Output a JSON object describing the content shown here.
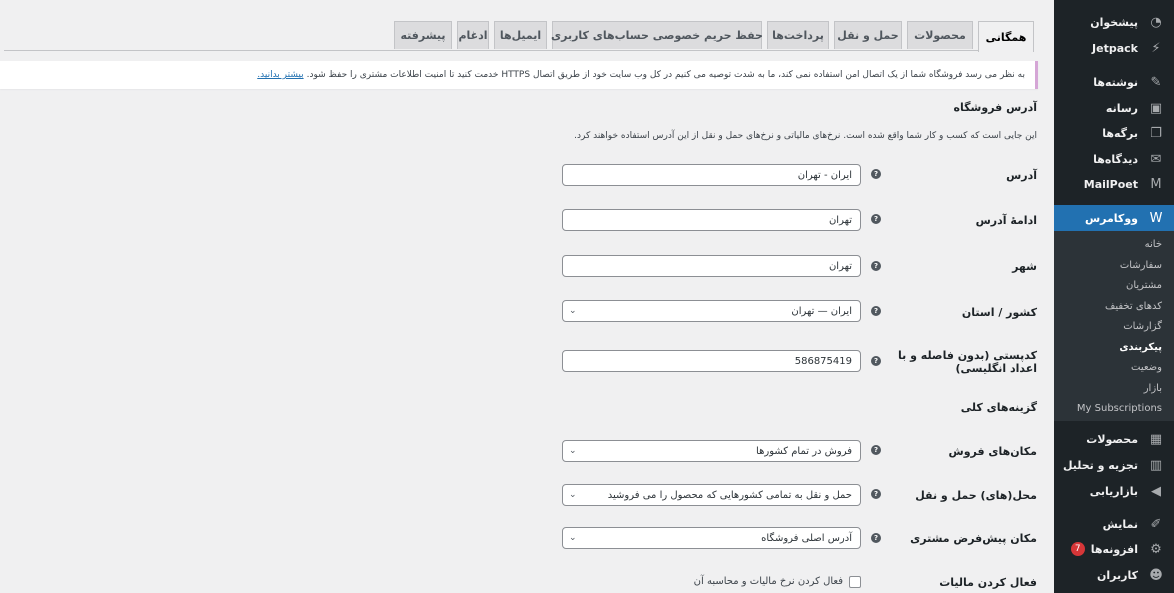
{
  "sidebar": {
    "items": [
      {
        "label": "پیشخوان",
        "icon": "dashboard-icon",
        "glyph": "◔"
      },
      {
        "label": "Jetpack",
        "icon": "jetpack-icon",
        "glyph": "⚡"
      },
      {
        "label": "نوشته‌ها",
        "icon": "pin-icon",
        "glyph": "✎"
      },
      {
        "label": "رسانه",
        "icon": "media-icon",
        "glyph": "▣"
      },
      {
        "label": "برگه‌ها",
        "icon": "pages-icon",
        "glyph": "❐"
      },
      {
        "label": "دیدگاه‌ها",
        "icon": "comments-icon",
        "glyph": "✉"
      },
      {
        "label": "MailPoet",
        "icon": "mailpoet-icon",
        "glyph": "M"
      },
      {
        "label": "ووکامرس",
        "icon": "woocommerce-icon",
        "glyph": "W"
      }
    ],
    "submenu": [
      {
        "label": "خانه"
      },
      {
        "label": "سفارشات"
      },
      {
        "label": "مشتریان"
      },
      {
        "label": "کدهای تخفیف"
      },
      {
        "label": "گزارشات"
      },
      {
        "label": "پیکربندی"
      },
      {
        "label": "وضعیت"
      },
      {
        "label": "بازار"
      },
      {
        "label": "My Subscriptions"
      }
    ],
    "items2": [
      {
        "label": "محصولات",
        "icon": "products-icon",
        "glyph": "▦"
      },
      {
        "label": "تجزیه و تحلیل",
        "icon": "analytics-icon",
        "glyph": "▥"
      },
      {
        "label": "بازاریابی",
        "icon": "megaphone-icon",
        "glyph": "◀"
      },
      {
        "label": "نمایش",
        "icon": "appearance-icon",
        "glyph": "✐"
      },
      {
        "label": "افزونه‌ها",
        "icon": "plugins-icon",
        "glyph": "⚙",
        "badge": "7"
      },
      {
        "label": "کاربران",
        "icon": "users-icon",
        "glyph": "☻"
      }
    ]
  },
  "tabs": [
    {
      "label": "همگانی",
      "active": true
    },
    {
      "label": "محصولات"
    },
    {
      "label": "حمل و نقل"
    },
    {
      "label": "پرداخت‌ها"
    },
    {
      "label": "حفظ حریم خصوصی حساب‌های کاربری"
    },
    {
      "label": "ایمیل‌ها"
    },
    {
      "label": "ادغام"
    },
    {
      "label": "پیشرفته"
    }
  ],
  "notice": {
    "text": "به نظر می رسد فروشگاه شما از یک اتصال امن استفاده نمی کند، ما به شدت توصیه می کنیم در کل وب سایت خود از طریق اتصال HTTPS خدمت کنید تا امنیت اطلاعات مشتری را حفظ شود.",
    "link": "بیشتر بدانید."
  },
  "store_address": {
    "title": "آدرس فروشگاه",
    "description": "این جایی است که کسب و کار شما واقع شده است. نرخ‌های مالیاتی و نرخ‌های حمل و نقل از این آدرس استفاده خواهند کرد.",
    "fields": [
      {
        "label": "آدرس",
        "value": "ایران - تهران",
        "type": "text"
      },
      {
        "label": "ادامهٔ آدرس",
        "value": "تهران",
        "type": "text"
      },
      {
        "label": "شهر",
        "value": "تهران",
        "type": "text"
      },
      {
        "label": "کشور / استان",
        "value": "ایران — تهران",
        "type": "select"
      },
      {
        "label": "کدپستی (بدون فاصله و با اعداد انگلیسی)",
        "value": "586875419",
        "type": "text"
      }
    ]
  },
  "general_options": {
    "title": "گزینه‌های کلی",
    "fields": [
      {
        "label": "مکان‌های فروش",
        "value": "فروش در تمام کشورها",
        "type": "select"
      },
      {
        "label": "محل(های) حمل و نقل",
        "value": "حمل و نقل به تمامی کشورهایی که محصول را می فروشید",
        "type": "select"
      },
      {
        "label": "مکان پیش‌فرض مشتری",
        "value": "آدرس اصلی فروشگاه",
        "type": "select"
      },
      {
        "label": "فعال کردن مالیات",
        "value": "فعال کردن نرخ مالیات و محاسبه آن",
        "type": "checkbox"
      }
    ]
  },
  "help_glyph": "?",
  "chevron_glyph": "⌄"
}
